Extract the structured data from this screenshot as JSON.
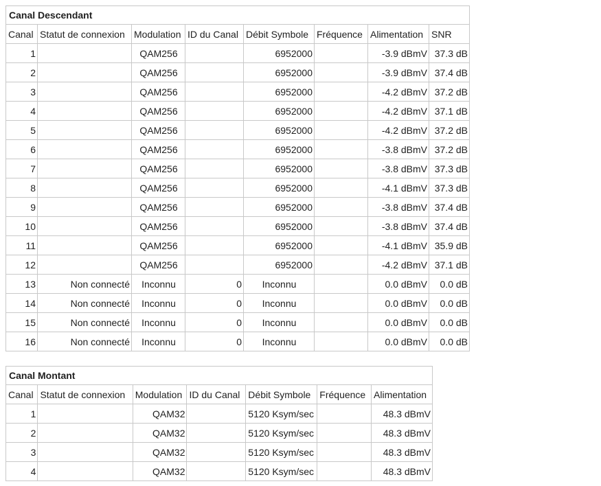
{
  "downstream": {
    "title": "Canal Descendant",
    "headers": [
      "Canal",
      "Statut de connexion",
      "Modulation",
      "ID du Canal",
      "Débit Symbole",
      "Fréquence",
      "Alimentation",
      "SNR"
    ],
    "rows": [
      [
        "1",
        "",
        "QAM256",
        "",
        "6952000",
        "",
        "-3.9 dBmV",
        "37.3 dB"
      ],
      [
        "2",
        "",
        "QAM256",
        "",
        "6952000",
        "",
        "-3.9 dBmV",
        "37.4 dB"
      ],
      [
        "3",
        "",
        "QAM256",
        "",
        "6952000",
        "",
        "-4.2 dBmV",
        "37.2 dB"
      ],
      [
        "4",
        "",
        "QAM256",
        "",
        "6952000",
        "",
        "-4.2 dBmV",
        "37.1 dB"
      ],
      [
        "5",
        "",
        "QAM256",
        "",
        "6952000",
        "",
        "-4.2 dBmV",
        "37.2 dB"
      ],
      [
        "6",
        "",
        "QAM256",
        "",
        "6952000",
        "",
        "-3.8 dBmV",
        "37.2 dB"
      ],
      [
        "7",
        "",
        "QAM256",
        "",
        "6952000",
        "",
        "-3.8 dBmV",
        "37.3 dB"
      ],
      [
        "8",
        "",
        "QAM256",
        "",
        "6952000",
        "",
        "-4.1 dBmV",
        "37.3 dB"
      ],
      [
        "9",
        "",
        "QAM256",
        "",
        "6952000",
        "",
        "-3.8 dBmV",
        "37.4 dB"
      ],
      [
        "10",
        "",
        "QAM256",
        "",
        "6952000",
        "",
        "-3.8 dBmV",
        "37.4 dB"
      ],
      [
        "11",
        "",
        "QAM256",
        "",
        "6952000",
        "",
        "-4.1 dBmV",
        "35.9 dB"
      ],
      [
        "12",
        "",
        "QAM256",
        "",
        "6952000",
        "",
        "-4.2 dBmV",
        "37.1 dB"
      ],
      [
        "13",
        "Non connecté",
        "Inconnu",
        "0",
        "Inconnu",
        "",
        "0.0 dBmV",
        "0.0 dB"
      ],
      [
        "14",
        "Non connecté",
        "Inconnu",
        "0",
        "Inconnu",
        "",
        "0.0 dBmV",
        "0.0 dB"
      ],
      [
        "15",
        "Non connecté",
        "Inconnu",
        "0",
        "Inconnu",
        "",
        "0.0 dBmV",
        "0.0 dB"
      ],
      [
        "16",
        "Non connecté",
        "Inconnu",
        "0",
        "Inconnu",
        "",
        "0.0 dBmV",
        "0.0 dB"
      ]
    ]
  },
  "upstream": {
    "title": "Canal Montant",
    "headers": [
      "Canal",
      "Statut de connexion",
      "Modulation",
      "ID du Canal",
      "Débit Symbole",
      "Fréquence",
      "Alimentation"
    ],
    "rows": [
      [
        "1",
        "",
        "QAM32",
        "",
        "5120 Ksym/sec",
        "",
        "48.3 dBmV"
      ],
      [
        "2",
        "",
        "QAM32",
        "",
        "5120 Ksym/sec",
        "",
        "48.3 dBmV"
      ],
      [
        "3",
        "",
        "QAM32",
        "",
        "5120 Ksym/sec",
        "",
        "48.3 dBmV"
      ],
      [
        "4",
        "",
        "QAM32",
        "",
        "5120 Ksym/sec",
        "",
        "48.3 dBmV"
      ]
    ]
  }
}
